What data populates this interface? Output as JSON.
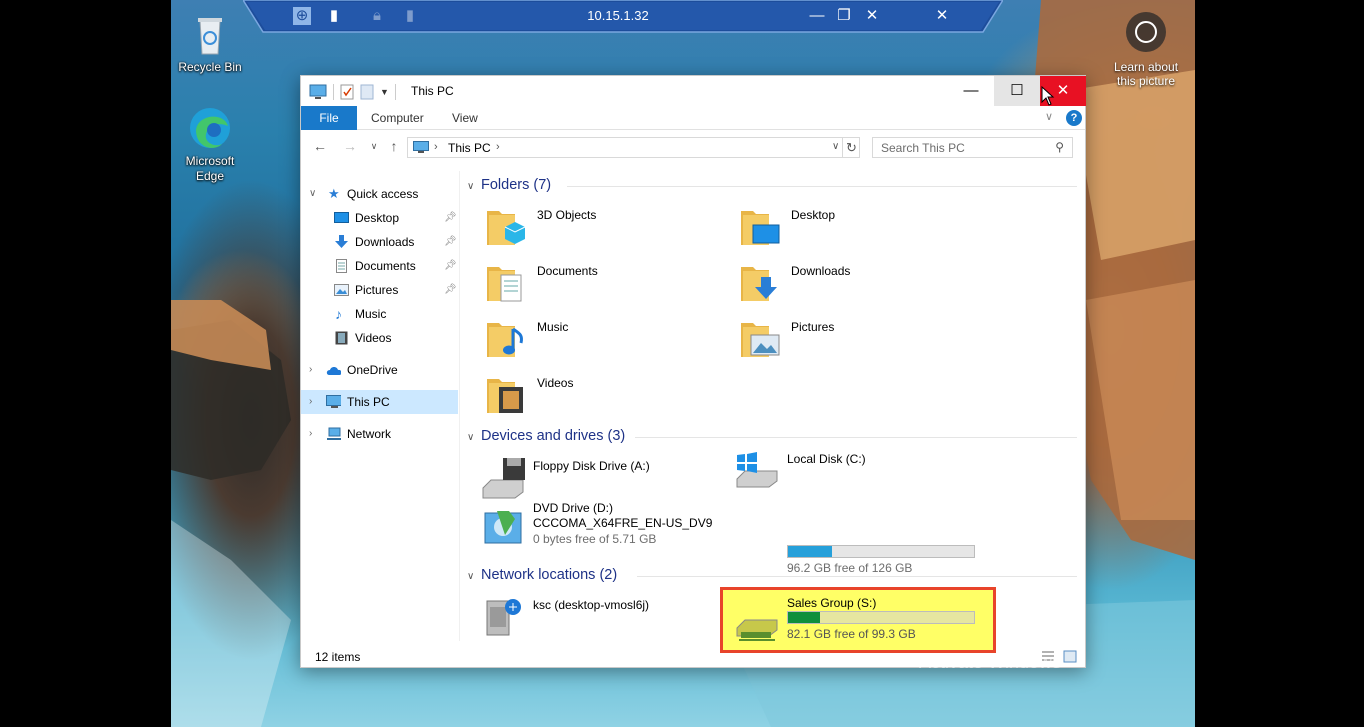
{
  "desktop": {
    "icons": [
      {
        "label": "Recycle Bin",
        "icon": "recycle-bin-icon"
      },
      {
        "label_line1": "Microsoft",
        "label_line2": "Edge",
        "icon": "edge-icon"
      }
    ],
    "learn_line1": "Learn about",
    "learn_line2": "this picture",
    "watermark": "Activate Windows"
  },
  "rdp_bar": {
    "title": "10.15.1.32",
    "buttons": [
      "pin-icon",
      "signal-icon",
      "lock-icon",
      "minimize-icon",
      "restore-icon",
      "close-icon"
    ]
  },
  "window": {
    "title": "This PC",
    "ribbon_tabs": [
      "File",
      "Computer",
      "View"
    ],
    "address": "This PC",
    "search_placeholder": "Search This PC",
    "status_count": "12 items"
  },
  "nav_pane": {
    "quick_access": "Quick access",
    "quick_items": [
      {
        "label": "Desktop",
        "pinned": true
      },
      {
        "label": "Downloads",
        "pinned": true
      },
      {
        "label": "Documents",
        "pinned": true
      },
      {
        "label": "Pictures",
        "pinned": true
      },
      {
        "label": "Music",
        "pinned": false
      },
      {
        "label": "Videos",
        "pinned": false
      }
    ],
    "onedrive": "OneDrive",
    "this_pc": "This PC",
    "network": "Network"
  },
  "content": {
    "folders_header": "Folders (7)",
    "folders": [
      "3D Objects",
      "Desktop",
      "Documents",
      "Downloads",
      "Music",
      "Pictures",
      "Videos"
    ],
    "devices_header": "Devices and drives (3)",
    "floppy": "Floppy Disk Drive (A:)",
    "local_disk": {
      "name": "Local Disk (C:)",
      "free": "96.2 GB free of 126 GB",
      "used_fraction": 0.237
    },
    "dvd": {
      "name": "DVD Drive (D:)",
      "label": "CCCOMA_X64FRE_EN-US_DV9",
      "free": "0 bytes free of 5.71 GB"
    },
    "network_header": "Network locations (2)",
    "ksc": "ksc (desktop-vmosl6j)",
    "sales": {
      "name": "Sales Group (S:)",
      "free": "82.1 GB free of 99.3 GB",
      "used_fraction": 0.173
    }
  },
  "colors": {
    "accent": "#1979ca",
    "close_red": "#e81123",
    "highlight_yellow": "#ffff66",
    "highlight_border": "#e8442a",
    "header_blue": "#1e3287"
  }
}
